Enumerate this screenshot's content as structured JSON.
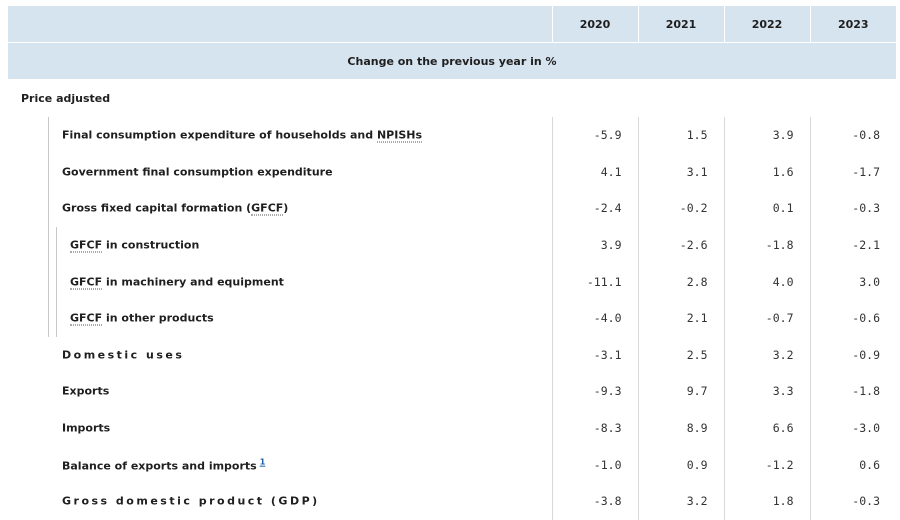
{
  "header": {
    "years": [
      "2020",
      "2021",
      "2022",
      "2023"
    ],
    "unit": "Change on the previous year in %"
  },
  "section_label": "Price adjusted",
  "rows": [
    {
      "pre": "Final consumption expenditure of households and ",
      "abbr": "NPISHs",
      "post": "",
      "values": [
        "-5.9",
        "1.5",
        "3.9",
        "-0.8"
      ]
    },
    {
      "pre": "Government final consumption expenditure",
      "abbr": "",
      "post": "",
      "values": [
        "4.1",
        "3.1",
        "1.6",
        "-1.7"
      ]
    },
    {
      "pre": "Gross fixed capital formation (",
      "abbr": "GFCF",
      "post": ")",
      "values": [
        "-2.4",
        "-0.2",
        "0.1",
        "-0.3"
      ]
    },
    {
      "pre": "",
      "abbr": "GFCF",
      "post": " in construction",
      "values": [
        "3.9",
        "-2.6",
        "-1.8",
        "-2.1"
      ]
    },
    {
      "pre": "",
      "abbr": "GFCF",
      "post": " in machinery and equipment",
      "values": [
        "-11.1",
        "2.8",
        "4.0",
        "3.0"
      ]
    },
    {
      "pre": "",
      "abbr": "GFCF",
      "post": " in other products",
      "values": [
        "-4.0",
        "2.1",
        "-0.7",
        "-0.6"
      ]
    },
    {
      "pre": "Domestic uses",
      "abbr": "",
      "post": "",
      "values": [
        "-3.1",
        "2.5",
        "3.2",
        "-0.9"
      ]
    },
    {
      "pre": "Exports",
      "abbr": "",
      "post": "",
      "values": [
        "-9.3",
        "9.7",
        "3.3",
        "-1.8"
      ]
    },
    {
      "pre": "Imports",
      "abbr": "",
      "post": "",
      "values": [
        "-8.3",
        "8.9",
        "6.6",
        "-3.0"
      ]
    },
    {
      "pre": "Balance of exports and imports",
      "abbr": "",
      "post": "",
      "footnote": "1",
      "values": [
        "-1.0",
        "0.9",
        "-1.2",
        "0.6"
      ]
    },
    {
      "pre": "Gross domestic product (GDP)",
      "abbr": "",
      "post": "",
      "values": [
        "-3.8",
        "3.2",
        "1.8",
        "-0.3"
      ]
    }
  ]
}
